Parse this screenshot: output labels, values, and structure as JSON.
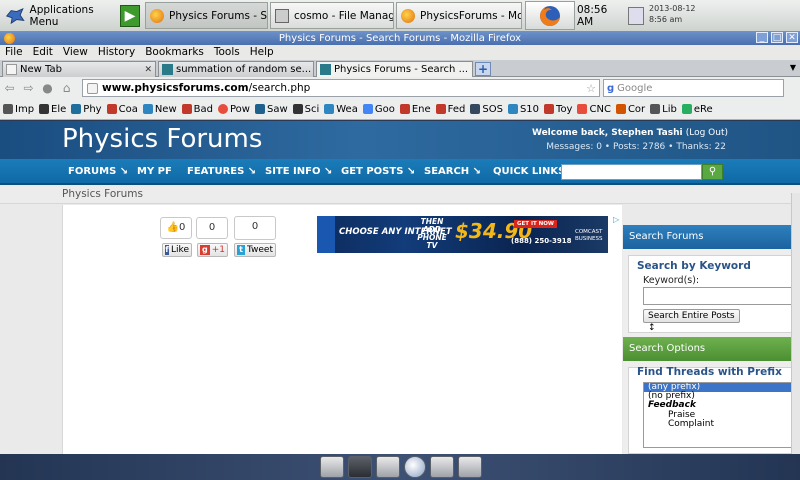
{
  "panel": {
    "apps_menu": "Applications Menu",
    "tasks": [
      {
        "label": "Physics Forums - Se..."
      },
      {
        "label": "cosmo - File Manager"
      },
      {
        "label": "PhysicsForums - Moz..."
      }
    ],
    "time": "08:56 AM",
    "date": "2013-08-12",
    "time_small": "8:56 am"
  },
  "window": {
    "title": "Physics Forums - Search Forums - Mozilla Firefox"
  },
  "menu": [
    "File",
    "Edit",
    "View",
    "History",
    "Bookmarks",
    "Tools",
    "Help"
  ],
  "tabs": [
    {
      "label": "New Tab"
    },
    {
      "label": "summation of random se..."
    },
    {
      "label": "Physics Forums - Search ..."
    }
  ],
  "tab_close": "✕",
  "new_tab": "+",
  "url": {
    "host": "www.physicsforums.com",
    "path": "/search.php"
  },
  "search_placeholder": "Google",
  "bookmarks": [
    {
      "label": "Imp",
      "color": "#555555"
    },
    {
      "label": "Ele",
      "color": "#333333"
    },
    {
      "label": "Phy",
      "color": "#1f6f9e"
    },
    {
      "label": "Coa",
      "color": "#c0392b"
    },
    {
      "label": "New",
      "color": "#2e86c1"
    },
    {
      "label": "Bad",
      "color": "#c0392b"
    },
    {
      "label": "Pow",
      "color": "#e74c3c"
    },
    {
      "label": "Saw",
      "color": "#1f618d"
    },
    {
      "label": "Sci",
      "color": "#333333"
    },
    {
      "label": "Wea",
      "color": "#2e86c1"
    },
    {
      "label": "Goo",
      "color": "#4285f4"
    },
    {
      "label": "Ene",
      "color": "#c0392b"
    },
    {
      "label": "Fed",
      "color": "#c0392b"
    },
    {
      "label": "SOS",
      "color": "#34495e"
    },
    {
      "label": "S10",
      "color": "#2e86c1"
    },
    {
      "label": "Toy",
      "color": "#c0392b"
    },
    {
      "label": "CNC",
      "color": "#e74c3c"
    },
    {
      "label": "Cor",
      "color": "#d35400"
    },
    {
      "label": "Lib",
      "color": "#555555"
    },
    {
      "label": "eRe",
      "color": "#27ae60"
    }
  ],
  "site": {
    "title": "Physics Forums",
    "welcome": "Welcome back, Stephen Tashi",
    "logout": "(Log Out)",
    "stats": "Messages: 0  •  Posts: 2786  •  Thanks: 22",
    "nav": [
      "FORUMS ↘",
      "MY PF",
      "FEATURES ↘",
      "SITE INFO ↘",
      "GET POSTS ↘",
      "SEARCH ↘",
      "QUICK LINKS ↘"
    ],
    "breadcrumb": "Physics Forums"
  },
  "share": {
    "like_count": "0",
    "gplus_count": "0",
    "tweet_count": "0",
    "like_label": "Like",
    "gplus_label": "+1",
    "tweet_label": "Tweet"
  },
  "ad": {
    "headline": "CHOOSE ANY INTERNET",
    "then_add": "THEN ADD PHONE TV",
    "price": "$34.90",
    "cta": "GET IT NOW",
    "phone": "(888) 250-3918",
    "brand": "COMCAST BUSINESS"
  },
  "sidebar": {
    "search_head": "Search Forums",
    "by_keyword": "Search by Keyword",
    "keyword_label": "Keyword(s):",
    "scope_select": "Search Entire Posts ↕",
    "options_head": "Search Options",
    "prefix_label": "Find Threads with Prefix",
    "prefix_options": [
      "(any prefix)",
      "(no prefix)",
      "Feedback",
      "Praise",
      "Complaint"
    ]
  }
}
